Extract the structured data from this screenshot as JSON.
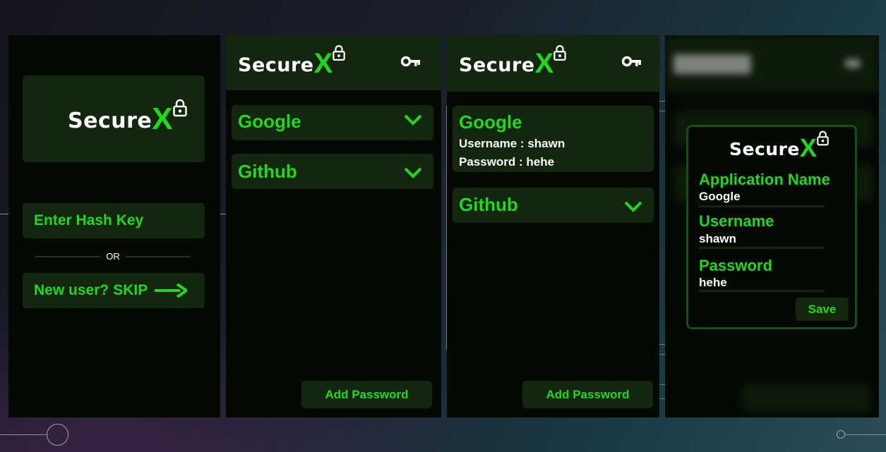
{
  "app": {
    "logo_secure": "Secure",
    "logo_x": "X"
  },
  "colors": {
    "accent": "#22d81f",
    "card": "#13270f",
    "screen_bg": "#040904"
  },
  "login": {
    "hash_placeholder": "Enter Hash Key",
    "or_label": "OR",
    "skip_prefix": "New user?",
    "skip_label": "SKIP"
  },
  "list_collapsed": {
    "entries": [
      {
        "name": "Google"
      },
      {
        "name": "Github"
      }
    ],
    "add_label": "Add Password"
  },
  "list_expanded": {
    "entries": [
      {
        "name": "Google",
        "username_line": "Username : shawn",
        "password_line": "Password : hehe"
      },
      {
        "name": "Github"
      }
    ],
    "add_label": "Add Password"
  },
  "add_modal": {
    "app_name_label": "Application Name",
    "app_name_value": "Google",
    "username_label": "Username",
    "username_value": "shawn",
    "password_label": "Password",
    "password_value": "hehe",
    "save_label": "Save"
  },
  "icons": [
    "lock-icon",
    "key-icon",
    "chevron-down-icon",
    "arrow-right-icon"
  ]
}
